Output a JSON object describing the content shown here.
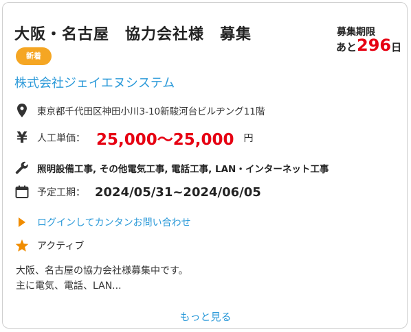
{
  "card": {
    "title": "大阪・名古屋　協力会社様　募集",
    "badge": "新着",
    "deadline": {
      "label": "募集期限",
      "prefix": "あと",
      "days": "296",
      "suffix": "日"
    },
    "company": "株式会社ジェイエヌシステム",
    "address": "東京都千代田区神田小川3-10新駿河台ビルヂング11階",
    "price": {
      "label": "人工単価：",
      "value": "25,000〜25,000",
      "unit": "円"
    },
    "works": "照明設備工事, その他電気工事, 電話工事, LAN・インターネット工事",
    "period": {
      "label": "予定工期：",
      "value": "2024/05/31~2024/06/05"
    },
    "login_link": "ログインしてカンタンお問い合わせ",
    "status": "アクティブ",
    "description": [
      "大阪、名古屋の協力会社様募集中です。",
      "主に電気、電話、LAN..."
    ],
    "more": "もっと見る"
  },
  "colors": {
    "accent_blue": "#2c9ad9",
    "red": "#e60012",
    "badge_orange": "#f5a623",
    "icon_orange": "#f08c00"
  },
  "icons": [
    "location-pin-icon",
    "yen-icon",
    "wrench-icon",
    "calendar-icon",
    "play-arrow-icon",
    "star-icon"
  ]
}
